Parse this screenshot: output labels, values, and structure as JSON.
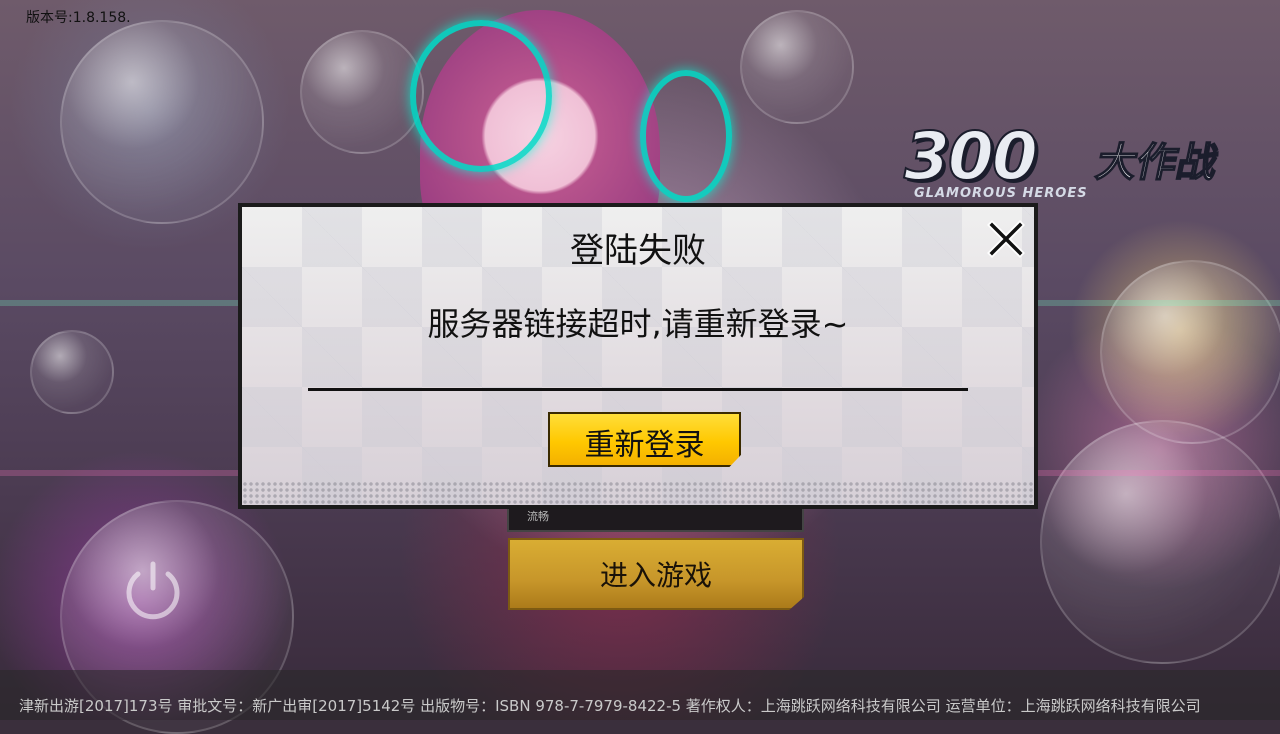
{
  "app": {
    "version_label": "版本号:1.8.158."
  },
  "logo": {
    "number_text": "300",
    "zh_title": "大作战",
    "en_subtitle": "GLAMOROUS HEROES"
  },
  "login_panel": {
    "server_text": "流畅",
    "enter_label": "进入游戏"
  },
  "dialog": {
    "title": "登陆失败",
    "message": "服务器链接超时,请重新登录~",
    "relogin_label": "重新登录",
    "close_icon": "close-icon"
  },
  "footer": {
    "legal_text": "津新出游[2017]173号  审批文号：新广出审[2017]5142号  出版物号：ISBN 978-7-7979-8422-5  著作权人：上海跳跃网络科技有限公司  运营单位：上海跳跃网络科技有限公司"
  },
  "colors": {
    "button_yellow": "#ffc800",
    "enter_gold": "#c7962a",
    "halo_cyan": "#00dcc8"
  }
}
